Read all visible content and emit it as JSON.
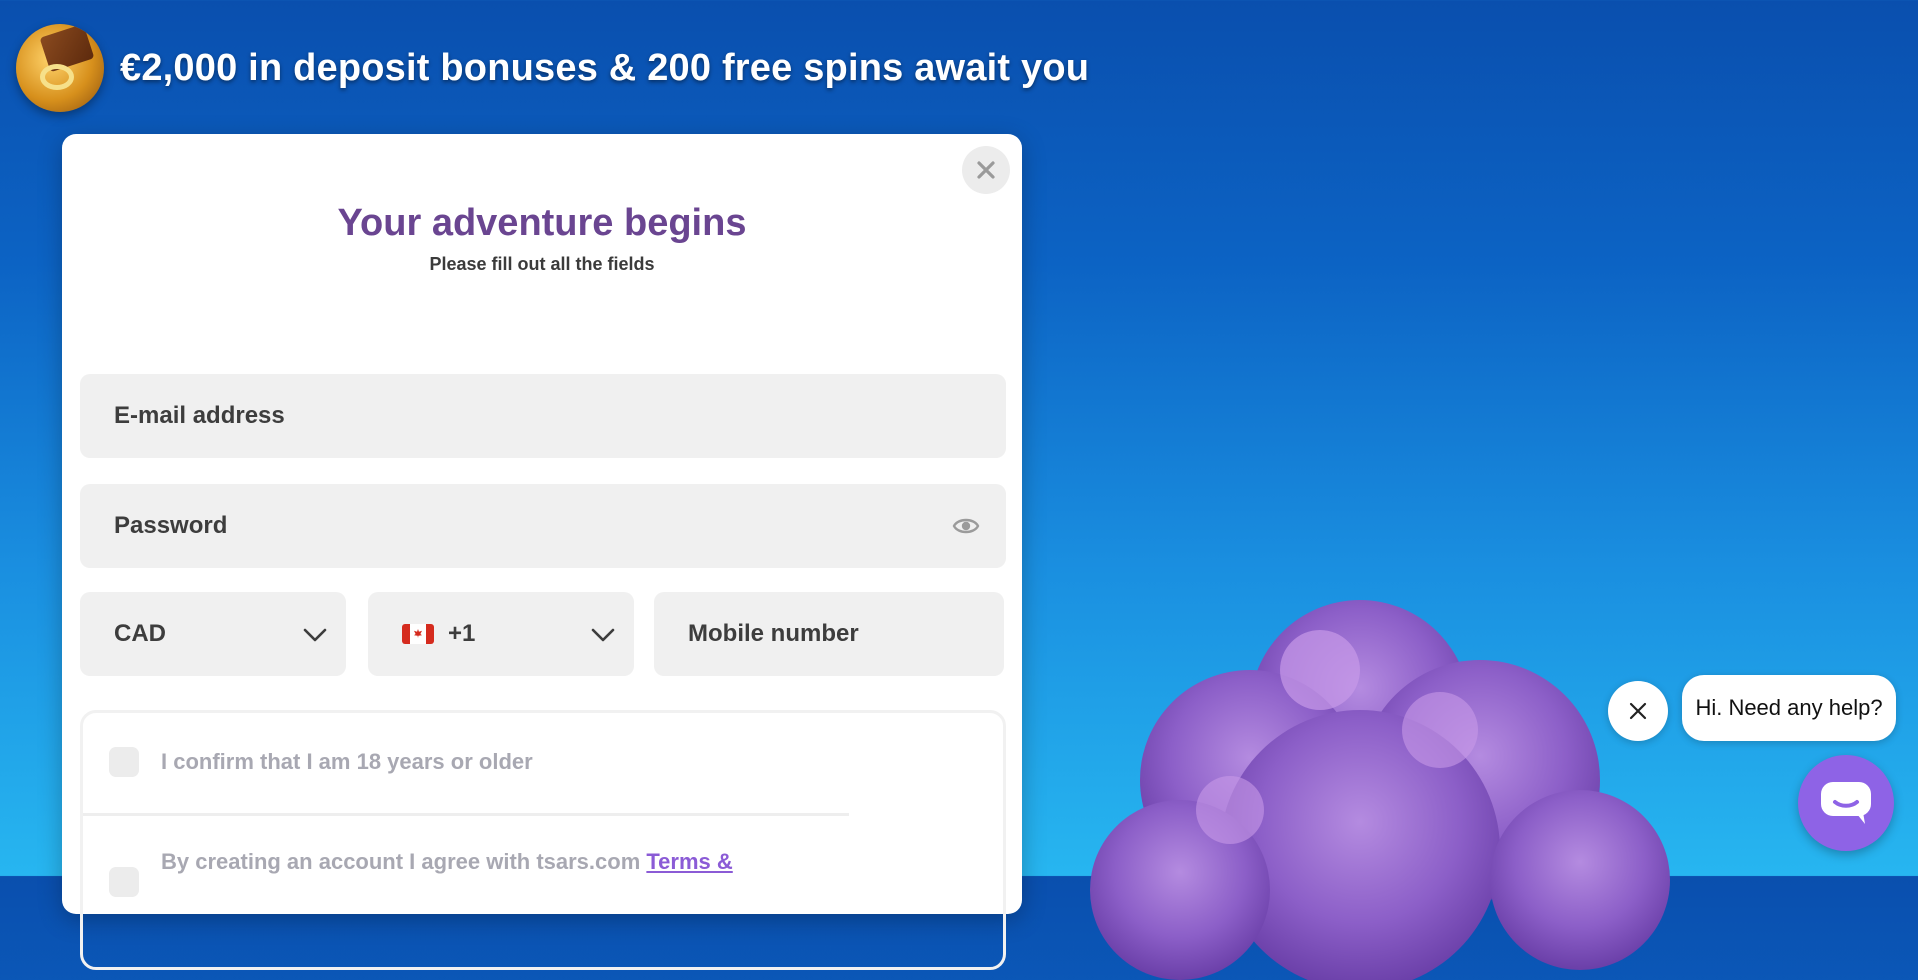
{
  "banner": {
    "text": "€2,000 in deposit bonuses & 200 free spins await you"
  },
  "modal": {
    "title": "Your adventure begins",
    "subtitle": "Please fill out all the fields",
    "email_placeholder": "E-mail address",
    "password_placeholder": "Password",
    "currency_value": "CAD",
    "phone_code_value": "+1",
    "mobile_placeholder": "Mobile number",
    "age_confirm_label": "I confirm that I am 18 years or older",
    "terms_text": "By creating an account I agree with tsars.com ",
    "terms_link": "Terms &"
  },
  "chat": {
    "greeting": "Hi. Need any help?"
  },
  "colors": {
    "title": "#6a4591",
    "accent": "#8e63e6",
    "link": "#8b5bd6"
  },
  "icons": [
    "close-icon",
    "eye-icon",
    "chevron-down-icon",
    "canada-flag-icon",
    "chat-icon"
  ]
}
